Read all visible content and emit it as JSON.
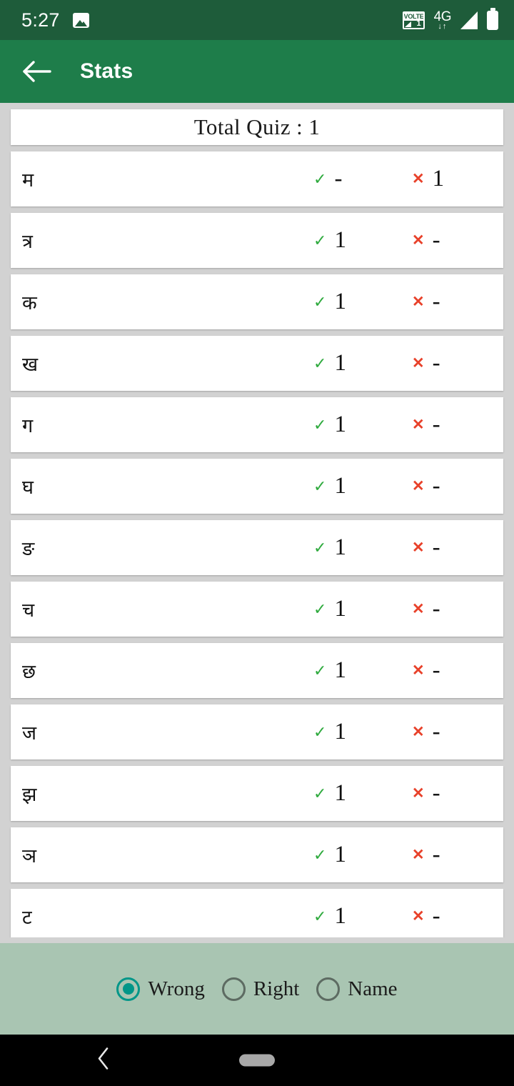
{
  "status_bar": {
    "time": "5:27",
    "photo_icon": "photo-icon",
    "volte_label": "VOLTE",
    "volte_sim": "1",
    "network": "4G",
    "network_arrows": "↓↑",
    "signal_icon": "signal-icon",
    "battery_icon": "battery-icon",
    "background_color": "#1e5c3a"
  },
  "app_bar": {
    "back_icon": "back-arrow-icon",
    "title": "Stats",
    "background_color": "#1e7d4a"
  },
  "list": {
    "total_label": "Total Quiz : 1",
    "tick_glyph": "✓",
    "cross_glyph": "✕",
    "tick_color": "#2eaa3d",
    "cross_color": "#e8412a",
    "rows": [
      {
        "letter": "म",
        "right": "-",
        "wrong": "1"
      },
      {
        "letter": "त्र",
        "right": "1",
        "wrong": "-"
      },
      {
        "letter": "क",
        "right": "1",
        "wrong": "-"
      },
      {
        "letter": "ख",
        "right": "1",
        "wrong": "-"
      },
      {
        "letter": "ग",
        "right": "1",
        "wrong": "-"
      },
      {
        "letter": "घ",
        "right": "1",
        "wrong": "-"
      },
      {
        "letter": "ङ",
        "right": "1",
        "wrong": "-"
      },
      {
        "letter": "च",
        "right": "1",
        "wrong": "-"
      },
      {
        "letter": "छ",
        "right": "1",
        "wrong": "-"
      },
      {
        "letter": "ज",
        "right": "1",
        "wrong": "-"
      },
      {
        "letter": "झ",
        "right": "1",
        "wrong": "-"
      },
      {
        "letter": "ञ",
        "right": "1",
        "wrong": "-"
      },
      {
        "letter": "ट",
        "right": "1",
        "wrong": "-"
      }
    ]
  },
  "filter_panel": {
    "background_color": "#a9c5b2",
    "accent_color": "#009688",
    "options": [
      {
        "label": "Wrong",
        "selected": true
      },
      {
        "label": "Right",
        "selected": false
      },
      {
        "label": "Name",
        "selected": false
      }
    ]
  },
  "nav_bar": {
    "back_icon": "chevron-left-icon",
    "home_indicator": "home-pill-icon"
  }
}
